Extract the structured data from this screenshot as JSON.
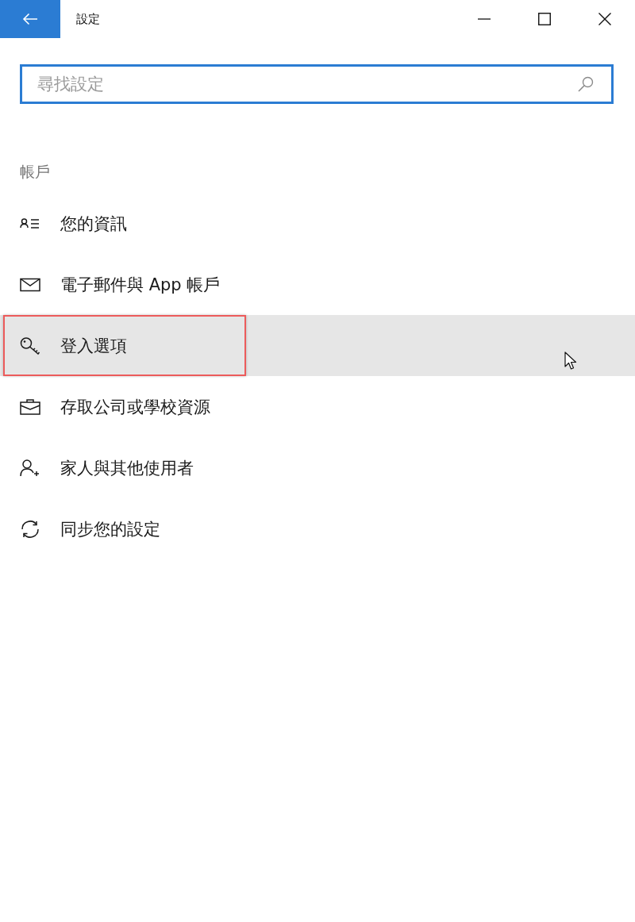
{
  "window": {
    "title": "設定"
  },
  "search": {
    "placeholder": "尋找設定"
  },
  "section": {
    "heading": "帳戶",
    "items": [
      {
        "kind": "profile",
        "label": "您的資訊",
        "hovered": false,
        "highlighted": false
      },
      {
        "kind": "mail",
        "label": "電子郵件與 App 帳戶",
        "hovered": false,
        "highlighted": false
      },
      {
        "kind": "key",
        "label": "登入選項",
        "hovered": true,
        "highlighted": true
      },
      {
        "kind": "work",
        "label": "存取公司或學校資源",
        "hovered": false,
        "highlighted": false
      },
      {
        "kind": "family",
        "label": "家人與其他使用者",
        "hovered": false,
        "highlighted": false
      },
      {
        "kind": "sync",
        "label": "同步您的設定",
        "hovered": false,
        "highlighted": false
      }
    ]
  }
}
